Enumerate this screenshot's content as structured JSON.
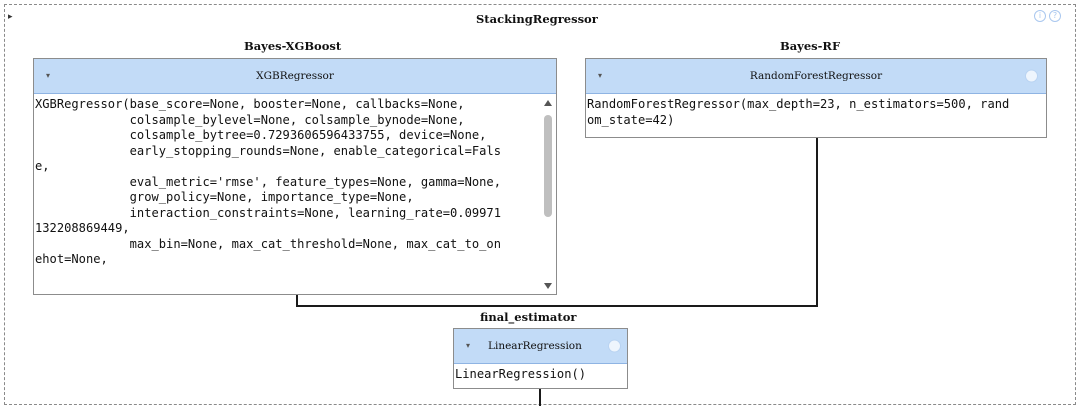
{
  "stacking": {
    "title": "StackingRegressor",
    "info_icons": [
      "i",
      "?"
    ]
  },
  "estimators": {
    "xgb": {
      "section_title": "Bayes-XGBoost",
      "header": "XGBRegressor",
      "code": "XGBRegressor(base_score=None, booster=None, callbacks=None,\n             colsample_bylevel=None, colsample_bynode=None,\n             colsample_bytree=0.7293606596433755, device=None,\n             early_stopping_rounds=None, enable_categorical=Fals\ne,\n             eval_metric='rmse', feature_types=None, gamma=None,\n             grow_policy=None, importance_type=None,\n             interaction_constraints=None, learning_rate=0.09971\n132208869449,\n             max_bin=None, max_cat_threshold=None, max_cat_to_on\nehot=None,"
    },
    "rf": {
      "section_title": "Bayes-RF",
      "header": "RandomForestRegressor",
      "code": "RandomForestRegressor(max_depth=23, n_estimators=500, rand\nom_state=42)"
    }
  },
  "final": {
    "section_title": "final_estimator",
    "header": "LinearRegression",
    "code": "LinearRegression()"
  },
  "icons": {
    "toggle": "▸",
    "collapse": "▾"
  }
}
